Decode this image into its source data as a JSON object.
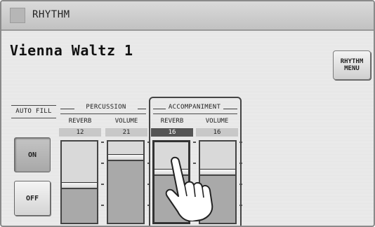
{
  "header": {
    "title": "RHYTHM",
    "menu_icon": "rhythm-icon"
  },
  "style_name": "Vienna Waltz 1",
  "rhythm_menu_label": "RHYTHM\nMENU",
  "auto_fill": {
    "label": "AUTO FILL",
    "on_label": "ON",
    "off_label": "OFF",
    "state": "ON"
  },
  "percussion": {
    "label": "PERCUSSION",
    "reverb": {
      "label": "REVERB",
      "value": "12",
      "level": 0.46
    },
    "volume": {
      "label": "VOLUME",
      "value": "21",
      "level": 0.8
    }
  },
  "accompaniment": {
    "label": "ACCOMPANIMENT",
    "reverb": {
      "label": "REVERB",
      "value": "16",
      "level": 0.62,
      "selected": true
    },
    "volume": {
      "label": "VOLUME",
      "value": "16",
      "level": 0.62
    }
  },
  "colors": {
    "fader_fill": "#a9a9a9",
    "selected_value": "#555555"
  }
}
